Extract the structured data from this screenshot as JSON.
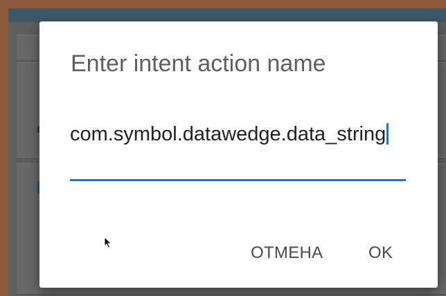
{
  "dialog": {
    "title": "Enter intent action name",
    "input_value": "com.symbol.datawedge.data_string",
    "cancel_label": "ОТМЕНА",
    "ok_label": "OK"
  },
  "colors": {
    "accent": "#1e79bf",
    "title_text": "#5f5f5f",
    "scrim": "#5e5e5e",
    "dialog_bg": "#ffffff"
  },
  "icons": {
    "pointer": "mouse-pointer-icon"
  }
}
